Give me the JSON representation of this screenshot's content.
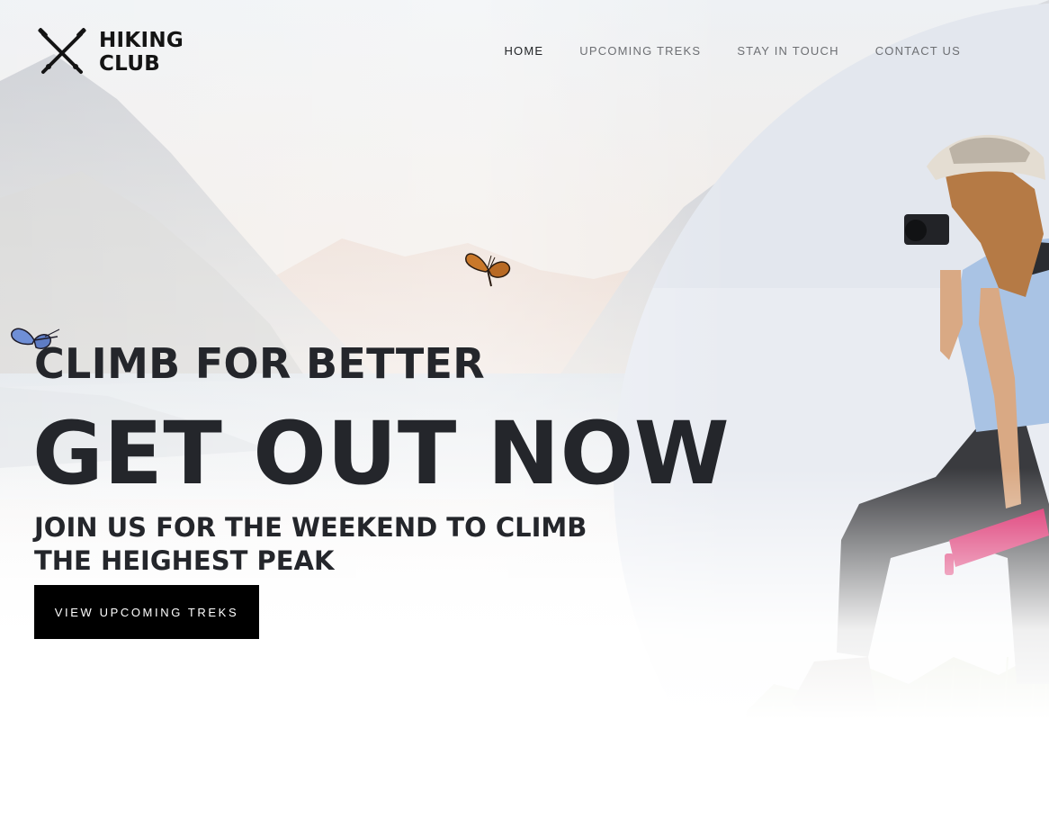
{
  "brand": {
    "line1": "HIKING",
    "line2": "CLUB",
    "icon": "crossed-hiking-poles-icon"
  },
  "nav": {
    "items": [
      {
        "label": "HOME",
        "active": true
      },
      {
        "label": "UPCOMING TREKS",
        "active": false
      },
      {
        "label": "STAY IN TOUCH",
        "active": false
      },
      {
        "label": "CONTACT US",
        "active": false
      }
    ]
  },
  "hero": {
    "kicker": "CLIMB FOR BETTER",
    "title": "GET OUT NOW",
    "subtitle": "JOIN US FOR THE WEEKEND TO CLIMB THE HEIGHEST PEAK",
    "cta_label": "VIEW UPCOMING TREKS"
  },
  "colors": {
    "text_dark": "#24262b",
    "nav_text": "#6d6f73",
    "button_bg": "#000000",
    "button_text": "#ffffff",
    "accent_bottle": "#d81b60"
  }
}
